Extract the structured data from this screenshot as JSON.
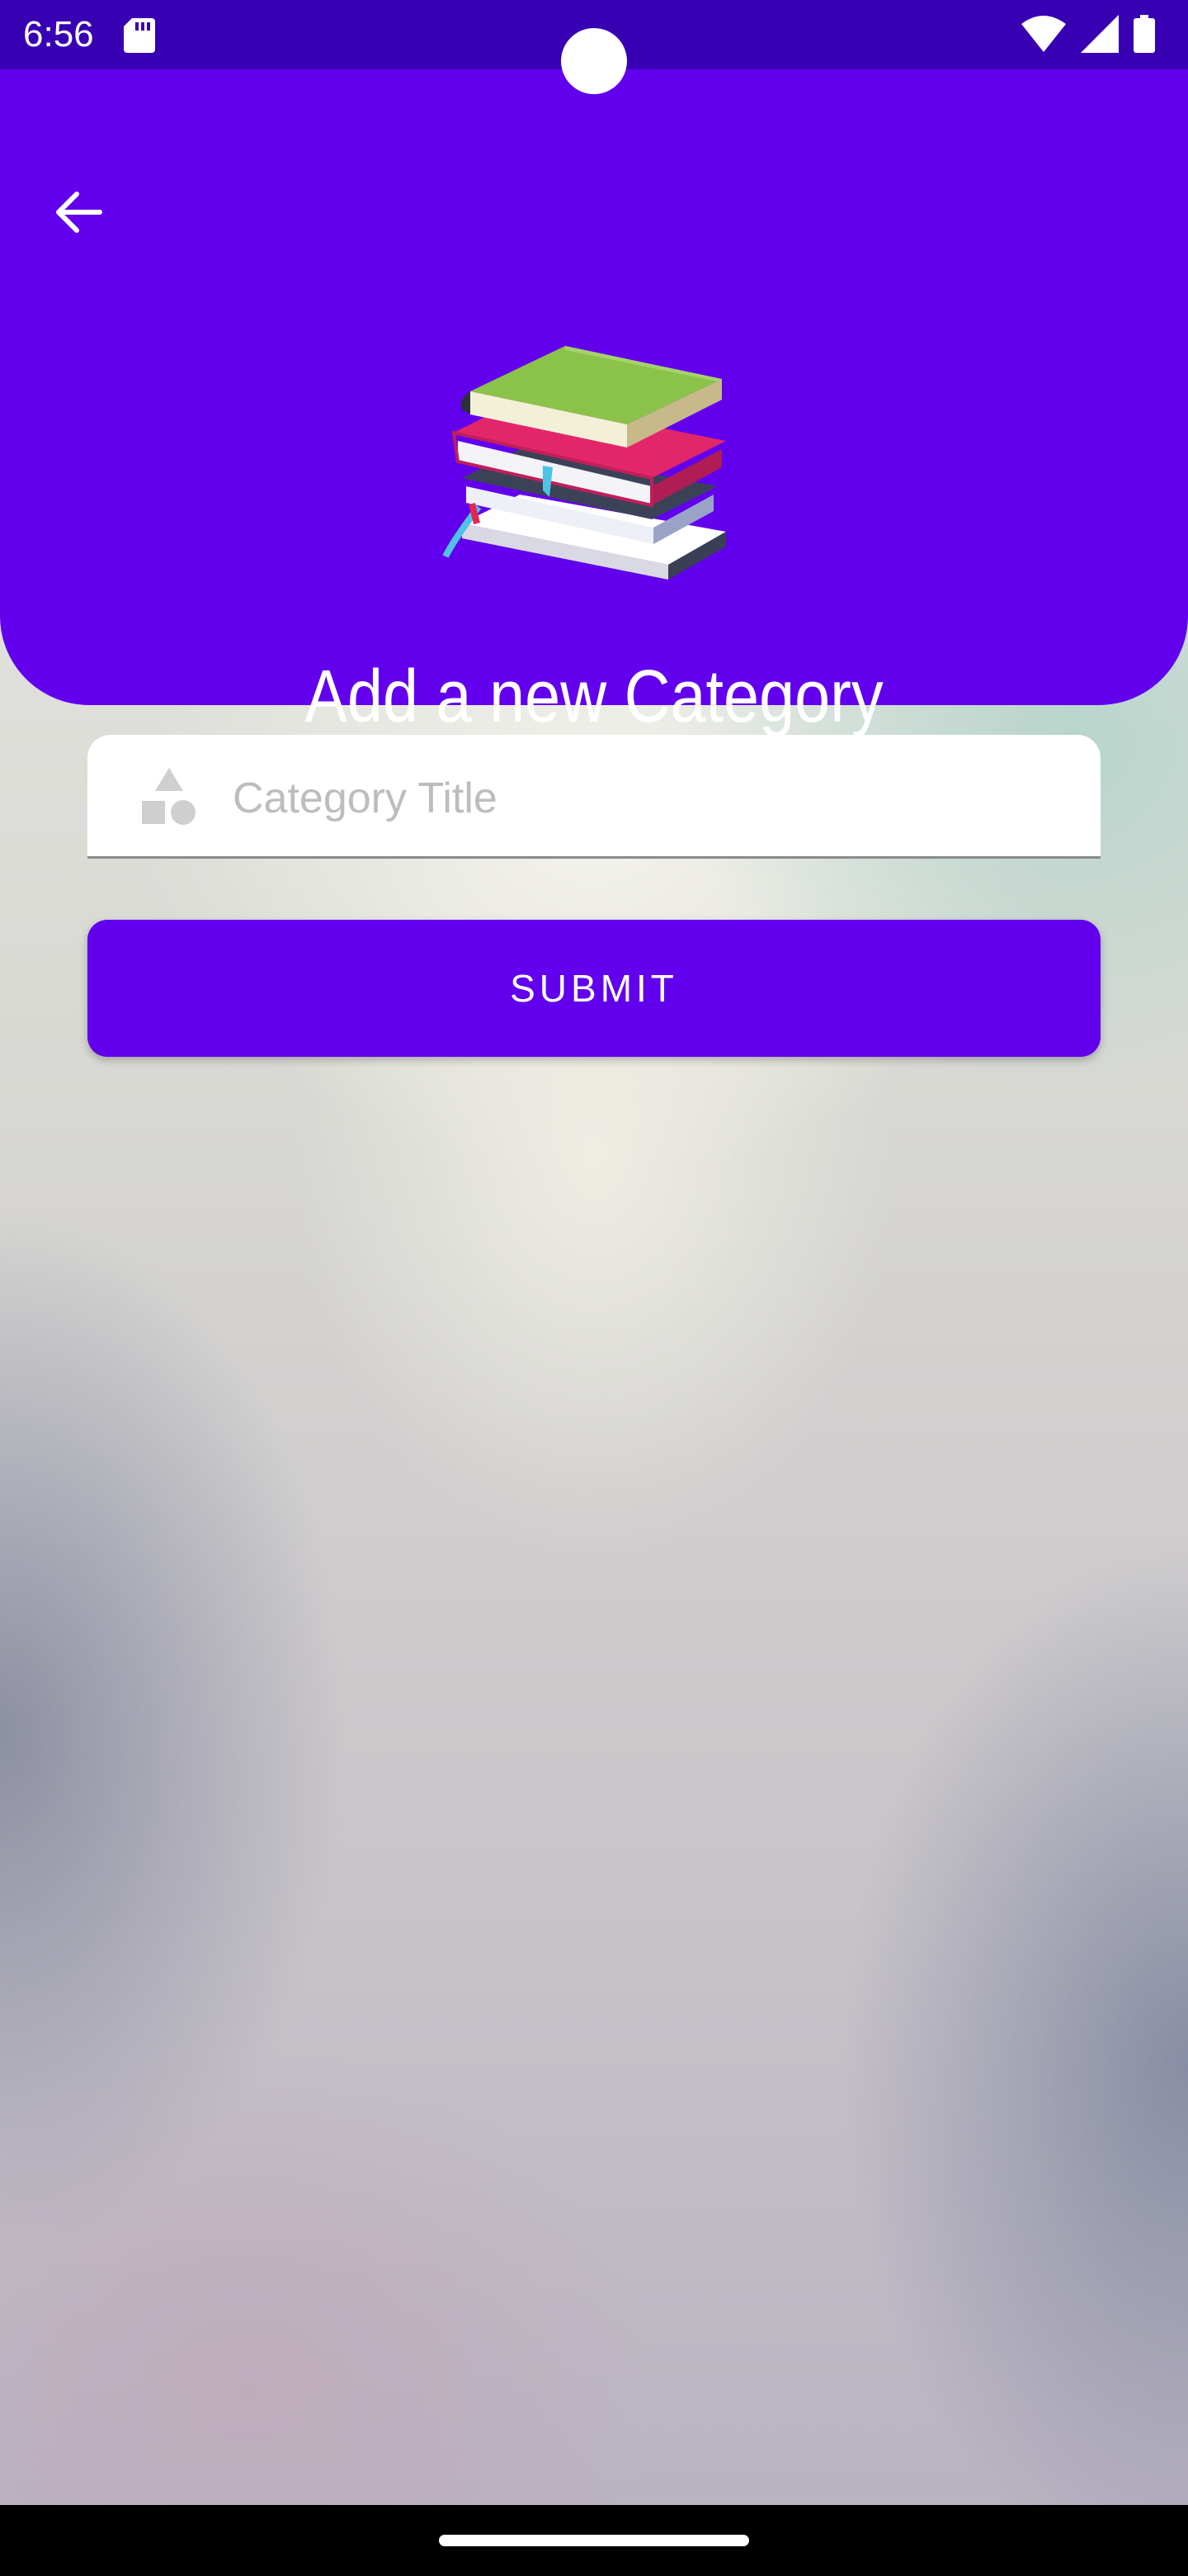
{
  "status_bar": {
    "time": "6:56",
    "icons": [
      "sd-card-icon",
      "wifi-icon",
      "signal-icon",
      "battery-icon"
    ]
  },
  "header": {
    "title": "Add a new Category",
    "back_icon": "arrow-left-icon",
    "illustration": "books-stack-icon",
    "color": "#6200ee"
  },
  "form": {
    "category_title": {
      "icon": "shapes-icon",
      "placeholder": "Category Title",
      "value": ""
    },
    "submit_label": "SUBMIT"
  },
  "colors": {
    "primary": "#6200ee",
    "status_bar": "#3700b3"
  }
}
